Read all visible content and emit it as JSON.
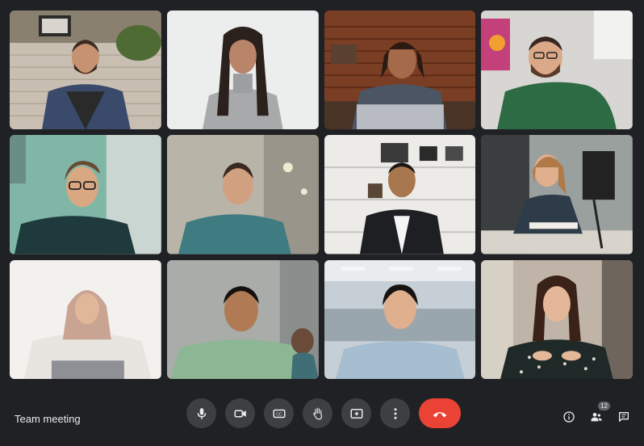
{
  "meeting": {
    "title": "Team meeting"
  },
  "participants_badge": {
    "count": "12"
  },
  "controls": [
    {
      "icon": "microphone-icon"
    },
    {
      "icon": "camera-icon"
    },
    {
      "icon": "captions-icon"
    },
    {
      "icon": "raise-hand-icon"
    },
    {
      "icon": "present-screen-icon"
    },
    {
      "icon": "more-options-icon"
    },
    {
      "icon": "end-call-icon",
      "color": "#ea4335"
    }
  ],
  "right_controls": [
    {
      "icon": "info-icon"
    },
    {
      "icon": "people-icon"
    },
    {
      "icon": "chat-icon"
    }
  ],
  "colors": {
    "background": "#202124",
    "control": "#3c4043",
    "end_call": "#ea4335",
    "text": "#e8eaed"
  }
}
